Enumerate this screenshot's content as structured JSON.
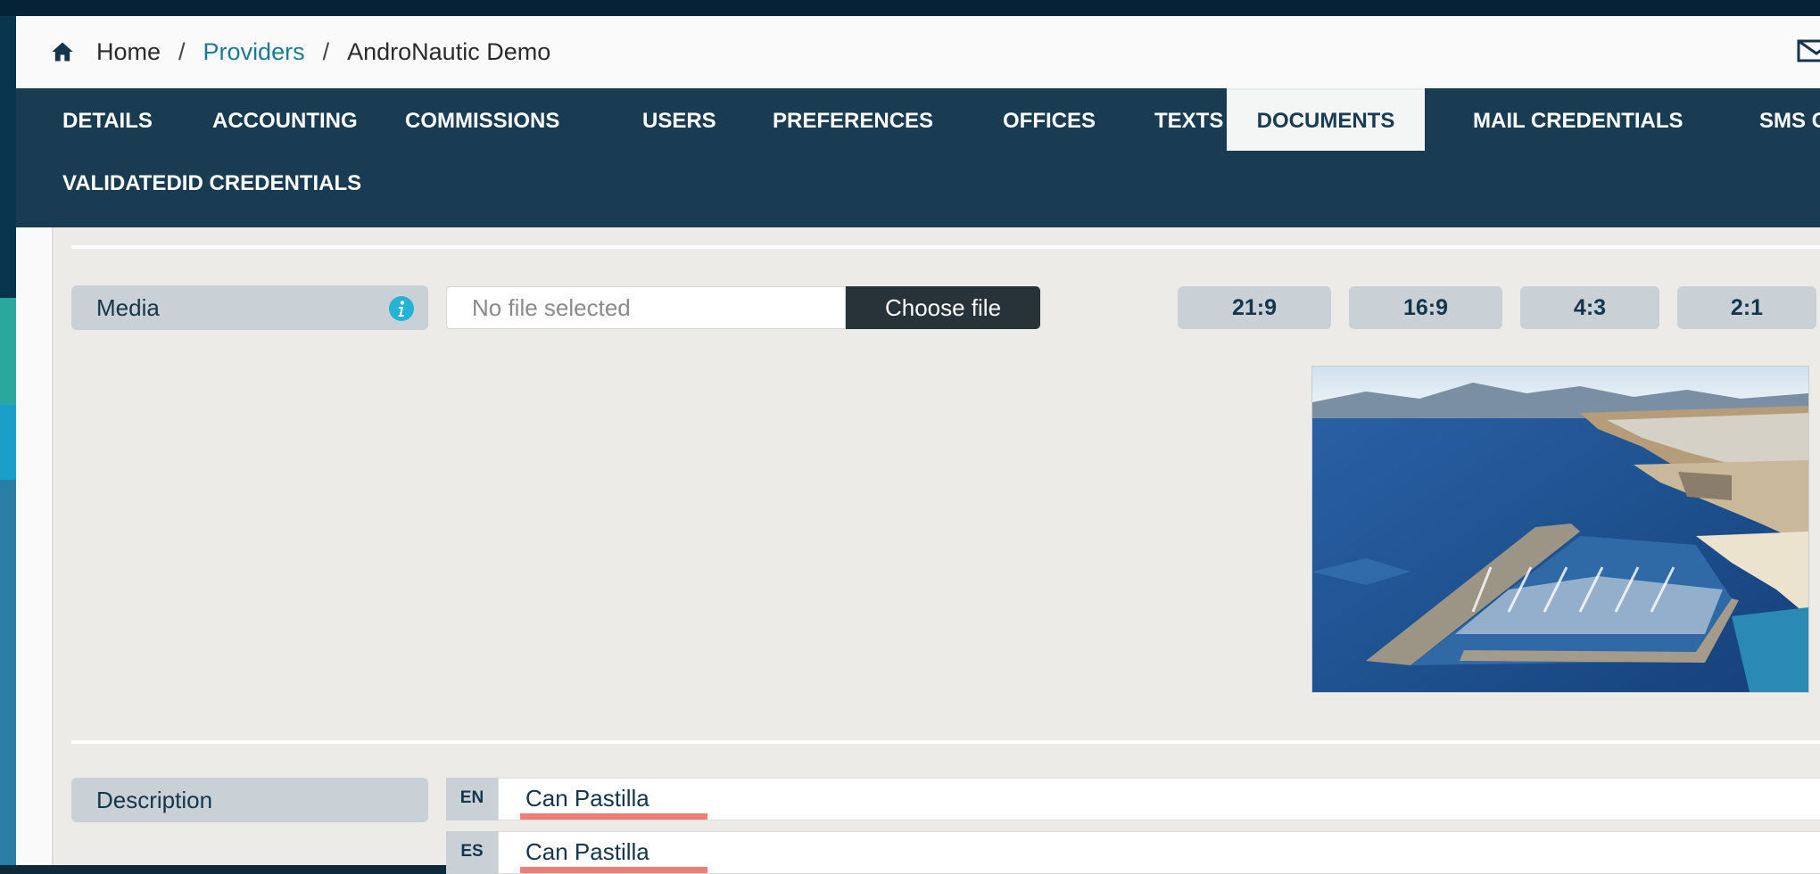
{
  "breadcrumb": {
    "home": "Home",
    "providers": "Providers",
    "current": "AndroNautic Demo",
    "separator": "/"
  },
  "tabs": [
    {
      "label": "DETAILS"
    },
    {
      "label": "ACCOUNTING"
    },
    {
      "label": "COMMISSIONS"
    },
    {
      "label": "USERS"
    },
    {
      "label": "PREFERENCES"
    },
    {
      "label": "OFFICES"
    },
    {
      "label": "TEXTS"
    },
    {
      "label": "DOCUMENTS",
      "active": true
    },
    {
      "label": "MAIL CREDENTIALS"
    },
    {
      "label": "SMS CRE"
    },
    {
      "label": "VALIDATEDID CREDENTIALS"
    }
  ],
  "media": {
    "label": "Media",
    "file_placeholder": "No file selected",
    "choose_label": "Choose file",
    "ratios": [
      "21:9",
      "16:9",
      "4:3",
      "2:1"
    ]
  },
  "description": {
    "label": "Description",
    "languages": [
      {
        "code": "EN",
        "value": "Can Pastilla"
      },
      {
        "code": "ES",
        "value": "Can Pastilla"
      }
    ]
  },
  "colors": {
    "nav": "#1a3c52",
    "link": "#1b7a93",
    "info": "#23b3d4",
    "spellcheck": "#f07e78"
  },
  "icons": [
    "home-icon",
    "mail-icon",
    "info-icon"
  ]
}
